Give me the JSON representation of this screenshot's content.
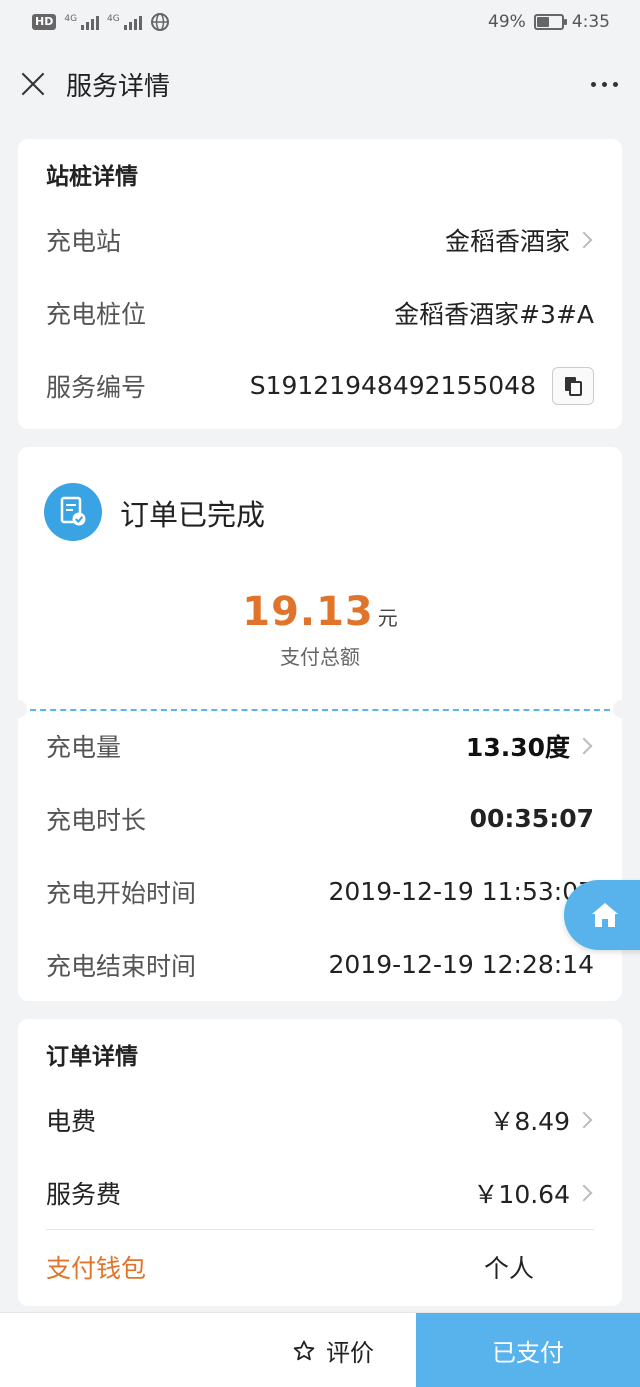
{
  "status_bar": {
    "hd": "HD",
    "net1": "4G",
    "net2": "4G",
    "battery": "49%",
    "time": "4:35"
  },
  "header": {
    "title": "服务详情"
  },
  "station_card": {
    "title": "站桩详情",
    "rows": [
      {
        "label": "充电站",
        "value": "金稻香酒家"
      },
      {
        "label": "充电桩位",
        "value": "金稻香酒家#3#A"
      },
      {
        "label": "服务编号",
        "value": "S19121948492155048"
      }
    ]
  },
  "order_card": {
    "status": "订单已完成",
    "amount": "19.13",
    "unit": "元",
    "amount_label": "支付总额",
    "rows": [
      {
        "label": "充电量",
        "value": "13.30度"
      },
      {
        "label": "充电时长",
        "value": "00:35:07"
      },
      {
        "label": "充电开始时间",
        "value": "2019-12-19 11:53:07"
      },
      {
        "label": "充电结束时间",
        "value": "2019-12-19 12:28:14"
      }
    ]
  },
  "bill_card": {
    "title": "订单详情",
    "rows": [
      {
        "label": "电费",
        "value": "￥8.49"
      },
      {
        "label": "服务费",
        "value": "￥10.64"
      }
    ],
    "wallet": {
      "label": "支付钱包",
      "value": "个人"
    }
  },
  "bottom": {
    "rate_label": "评价",
    "paid_label": "已支付"
  },
  "colors": {
    "accent_blue": "#58b3ec",
    "amount_orange": "#e0742a"
  }
}
